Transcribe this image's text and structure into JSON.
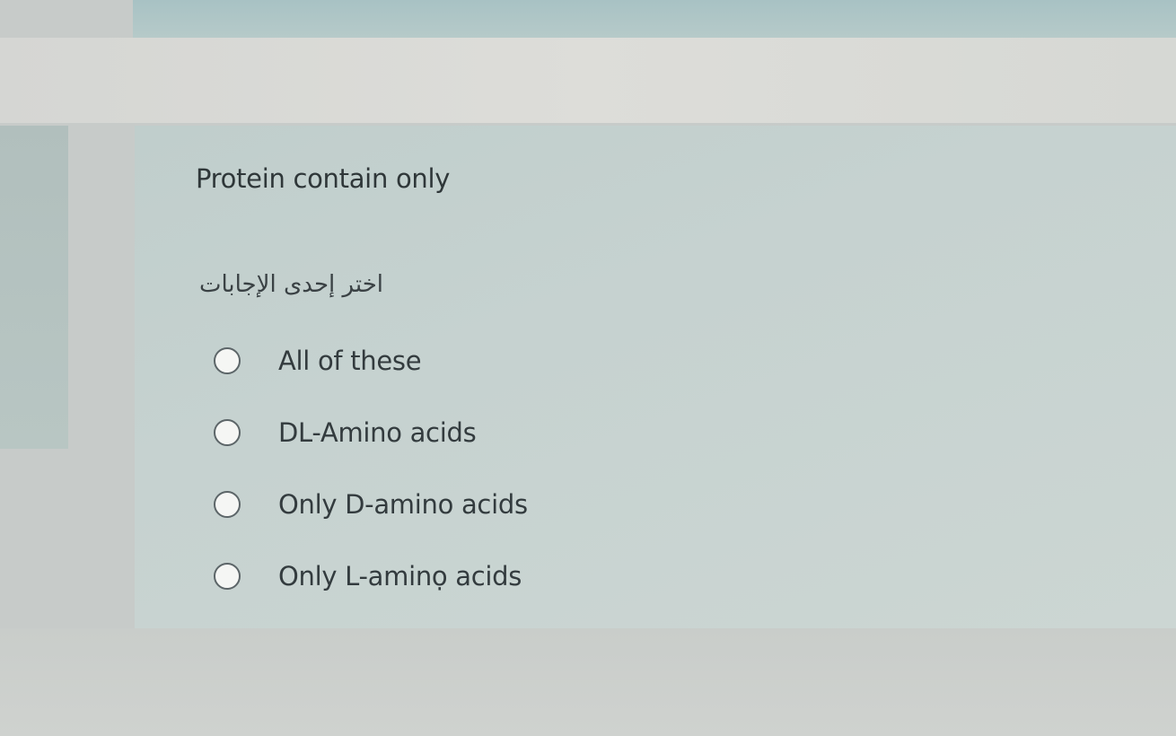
{
  "question": {
    "text": "Protein contain only",
    "prompt": "اختر إحدى الإجابات"
  },
  "options": [
    {
      "label": "All of these",
      "selected": false
    },
    {
      "label": "DL-Amino acids",
      "selected": false
    },
    {
      "label": "Only D-amino acids",
      "selected": false
    },
    {
      "label": "Only L-aminọ acids",
      "selected": false
    }
  ],
  "colors": {
    "panel": "#c6d2d0",
    "text": "#2f3739",
    "radio_border": "#5c6568"
  }
}
